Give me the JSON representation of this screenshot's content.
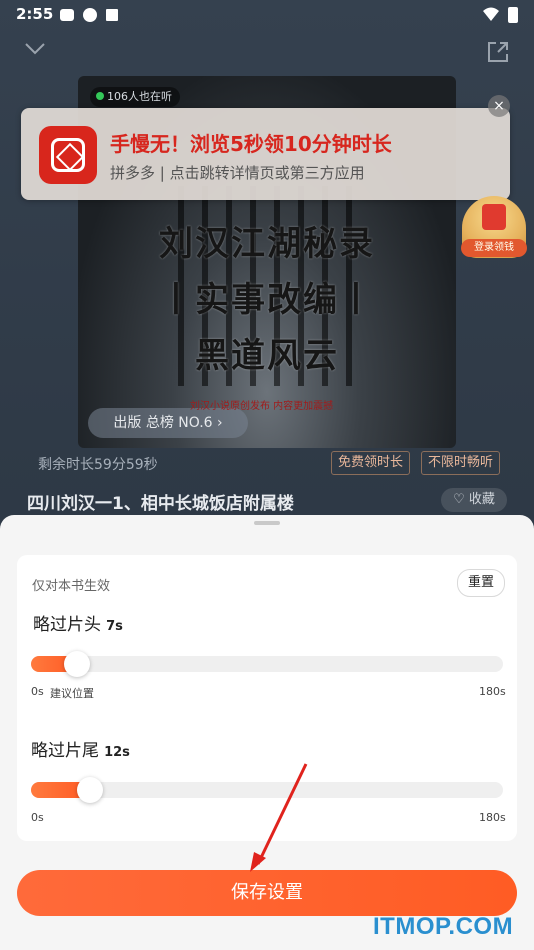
{
  "status_bar": {
    "time": "2:55"
  },
  "player": {
    "listeners": "106人也在听",
    "cover_title_lines": [
      "刘汉江湖秘录",
      "丨实事改编丨",
      "黑道风云"
    ],
    "rank_label": "出版 总榜 NO.6",
    "cover_note": "刘汉小说原创发布 内容更加震撼",
    "remaining_time": "剩余时长59分59秒",
    "chip_free": "免费领时长",
    "chip_unlimited": "不限时畅听",
    "chapter_title": "四川刘汉一1、相中长城饭店附属楼",
    "collect_label": "收藏"
  },
  "ad": {
    "title": "手慢无！浏览5秒领10分钟时长",
    "subtitle": "拼多多 | 点击跳转详情页或第三方应用",
    "close_label": "×"
  },
  "redpacket": {
    "label": "登录领钱"
  },
  "settings": {
    "scope": "仅对本书生效",
    "reset": "重置",
    "intro": {
      "label": "略过片头",
      "value": "7s",
      "min": "0s",
      "suggest": "建议位置",
      "max": "180s",
      "level_seconds": 7
    },
    "outro": {
      "label": "略过片尾",
      "value": "12s",
      "min": "0s",
      "max": "180s",
      "level_seconds": 12
    },
    "save": "保存设置"
  },
  "watermark": "ITMOP.COM",
  "colors": {
    "accent": "#ff5a24",
    "ad_title": "#d7261e",
    "watermark": "#2a8fcf"
  }
}
